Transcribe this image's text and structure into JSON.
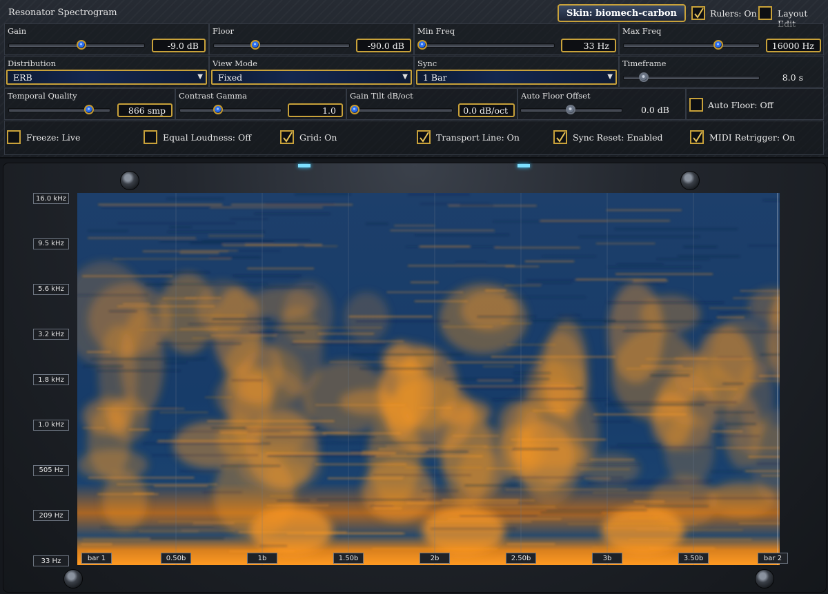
{
  "app": {
    "title": "Resonator Spectrogram"
  },
  "header": {
    "skin_label": "Skin: biomech-carbon",
    "rulers_label": "Rulers: On",
    "rulers_checked": true,
    "layout_edit_label": "Layout Edit",
    "layout_edit_checked": false
  },
  "row1": {
    "gain": {
      "label": "Gain",
      "value": "-9.0 dB",
      "position": 0.52
    },
    "floor": {
      "label": "Floor",
      "value": "-90.0 dB",
      "position": 0.31
    },
    "min_freq": {
      "label": "Min Freq",
      "value": "33 Hz",
      "position": 0.0
    },
    "max_freq": {
      "label": "Max Freq",
      "value": "16000 Hz",
      "position": 0.72
    }
  },
  "row2": {
    "distribution": {
      "label": "Distribution",
      "value": "ERB"
    },
    "view_mode": {
      "label": "View Mode",
      "value": "Fixed"
    },
    "sync": {
      "label": "Sync",
      "value": "1 Bar"
    },
    "timeframe": {
      "label": "Timeframe",
      "value": "8.0 s",
      "position": 0.17
    }
  },
  "row3": {
    "temporal_quality": {
      "label": "Temporal Quality",
      "value": "866 smp",
      "position": 0.79
    },
    "contrast_gamma": {
      "label": "Contrast Gamma",
      "value": "1.0",
      "position": 0.4
    },
    "gain_tilt": {
      "label": "Gain Tilt dB/oct",
      "value": "0.0 dB/oct",
      "position": 0.0
    },
    "auto_floor_offset": {
      "label": "Auto Floor Offset",
      "value": "0.0 dB",
      "position": 0.5
    },
    "auto_floor": {
      "label": "Auto Floor: Off",
      "checked": false
    }
  },
  "row4": [
    {
      "label": "Freeze: Live",
      "checked": false
    },
    {
      "label": "Equal Loudness: Off",
      "checked": false
    },
    {
      "label": "Grid: On",
      "checked": true
    },
    {
      "label": "Transport Line: On",
      "checked": true
    },
    {
      "label": "Sync Reset: Enabled",
      "checked": true
    },
    {
      "label": "MIDI Retrigger: On",
      "checked": true
    }
  ],
  "spectrogram": {
    "freq_ticks": [
      "16.0 kHz",
      "9.5 kHz",
      "5.6 kHz",
      "3.2 kHz",
      "1.8 kHz",
      "1.0 kHz",
      "505 Hz",
      "209 Hz",
      "33 Hz"
    ],
    "time_ticks": [
      "bar 1",
      "0.50b",
      "1b",
      "1.50b",
      "2b",
      "2.50b",
      "3b",
      "3.50b",
      "bar 2"
    ],
    "colors": {
      "low": "#163a66",
      "high": "#ff9a22",
      "grid": "#6a7a8e"
    }
  }
}
